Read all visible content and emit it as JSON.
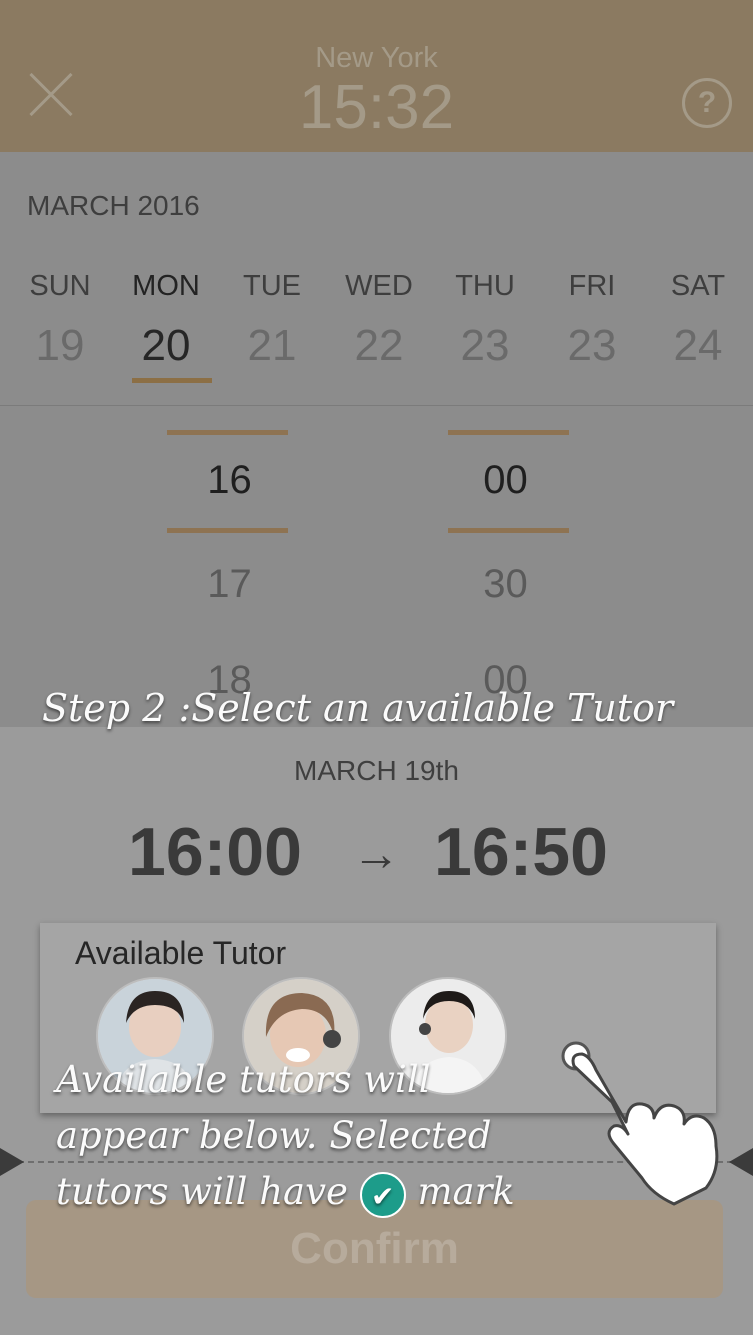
{
  "header": {
    "city": "New York",
    "clock": "15:32",
    "close_icon": "close-icon",
    "help_icon": "help-icon",
    "help_glyph": "?"
  },
  "calendar": {
    "month": "MARCH 2016",
    "days": [
      {
        "name": "SUN",
        "date": "19"
      },
      {
        "name": "MON",
        "date": "20",
        "selected": true
      },
      {
        "name": "TUE",
        "date": "21"
      },
      {
        "name": "WED",
        "date": "22"
      },
      {
        "name": "THU",
        "date": "23"
      },
      {
        "name": "FRI",
        "date": "23"
      },
      {
        "name": "SAT",
        "date": "24"
      }
    ]
  },
  "time_picker": {
    "hours": [
      "16",
      "17",
      "18"
    ],
    "minutes": [
      "00",
      "30",
      "00"
    ]
  },
  "overlay": {
    "step_text": "Step 2 :Select an available Tutor",
    "tip_line1": "Available tutors will",
    "tip_line2": "appear below. Selected",
    "tip_line3_a": "tutors will have",
    "tip_line3_b": "mark"
  },
  "booking": {
    "date": "MARCH 19th",
    "start": "16:00",
    "end": "16:50",
    "arrow": "→",
    "tutor_title": "Available Tutor",
    "tutor_count": 3,
    "confirm_label": "Confirm"
  },
  "colors": {
    "header_bg": "#8b7a61",
    "accent": "#8c6f45",
    "check": "#1d9c8a",
    "confirm_bg": "#a69784"
  }
}
